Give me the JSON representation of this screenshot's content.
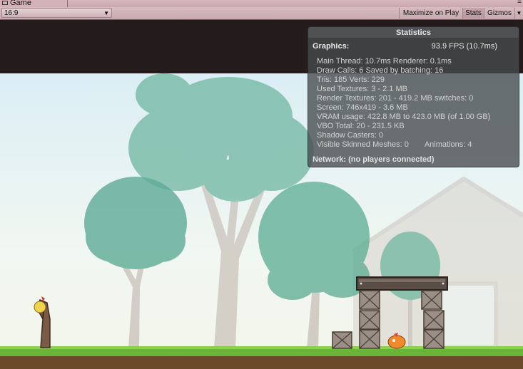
{
  "window": {
    "tab_title": "Game"
  },
  "toolbar": {
    "aspect_ratio": "16:9",
    "maximize_on_play": "Maximize on Play",
    "stats": "Stats",
    "gizmos": "Gizmos"
  },
  "statistics": {
    "title": "Statistics",
    "graphics_label": "Graphics:",
    "fps": "93.9 FPS (10.7ms)",
    "main_thread": "Main Thread: 10.7ms  Renderer: 0.1ms",
    "draw_calls": "Draw Calls: 6  Saved by batching: 16",
    "tris": "Tris: 185    Verts: 229",
    "used_textures": "Used Textures: 3 - 2.1 MB",
    "render_textures": "Render Textures: 201 - 419.2 MB    switches: 0",
    "screen": "Screen: 746x419 - 3.6 MB",
    "vram": "VRAM usage: 422.8 MB to 423.0 MB (of 1.00 GB)",
    "vbo": "VBO Total: 20 - 231.5 KB",
    "shadow_casters": "Shadow Casters: 0",
    "skinned_meshes": "Visible Skinned Meshes: 0",
    "animations": "Animations: 4",
    "network": "Network: (no players connected)"
  },
  "colors": {
    "tree_green": "#6fb6a0",
    "trunk": "#c9c3bb",
    "grass": "#6ab43a",
    "soil": "#6b4a2c",
    "crate": "#9a8f86",
    "plank": "#5a4d45"
  },
  "icons": [
    "game-tab-icon",
    "dropdown-arrow-icon",
    "menu-icon"
  ]
}
